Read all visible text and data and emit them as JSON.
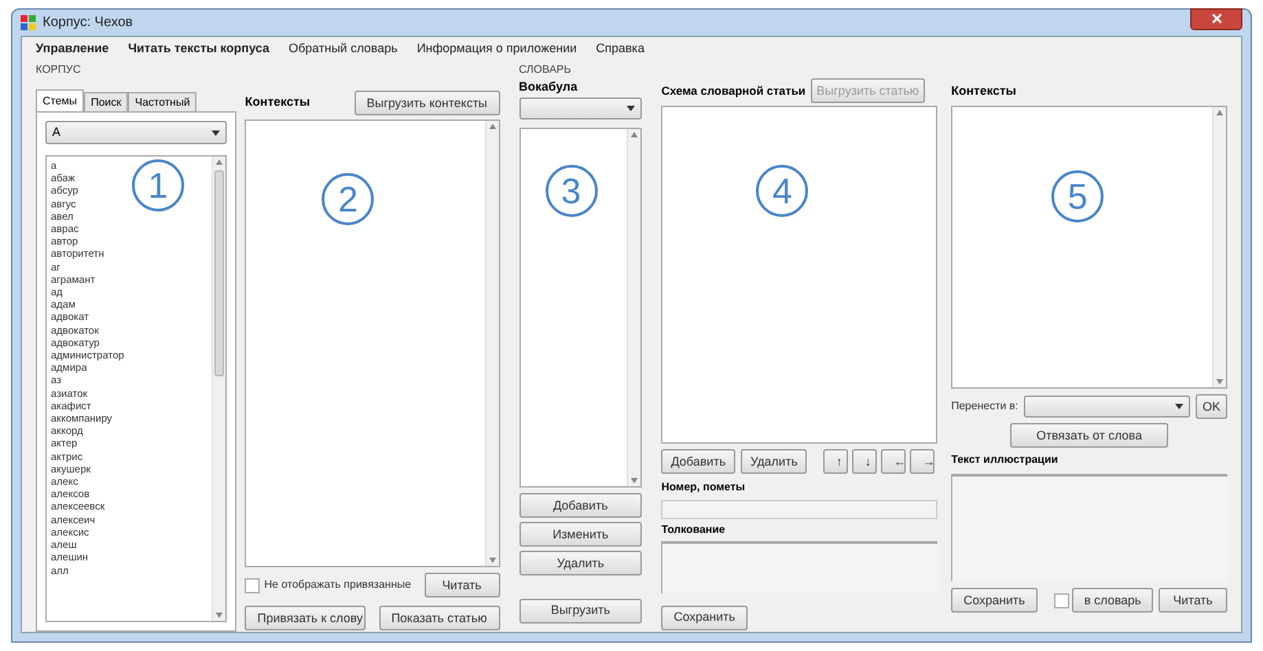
{
  "window": {
    "title": "Корпус: Чехов"
  },
  "menu": [
    {
      "label": "Управление",
      "bold": true
    },
    {
      "label": "Читать тексты корпуса",
      "bold": true
    },
    {
      "label": "Обратный словарь",
      "bold": false
    },
    {
      "label": "Информация о приложении",
      "bold": false
    },
    {
      "label": "Справка",
      "bold": false
    }
  ],
  "corpus": {
    "label": "КОРПУС",
    "tabs": [
      {
        "label": "Стемы",
        "selected": true
      },
      {
        "label": "Поиск",
        "selected": false
      },
      {
        "label": "Частотный",
        "selected": false
      }
    ],
    "letter_select": "А",
    "annotation": "1",
    "words": [
      "а",
      "абаж",
      "абсур",
      "авгус",
      "авел",
      "аврас",
      "автор",
      "авторитетн",
      "аг",
      "аграмант",
      "ад",
      "адам",
      "адвокат",
      "адвокаток",
      "адвокатур",
      "администратор",
      "адмира",
      "аз",
      "азиаток",
      "акафист",
      "аккомпаниру",
      "аккорд",
      "актер",
      "актрис",
      "акушерк",
      "алекс",
      "алексов",
      "алексеевск",
      "алексеич",
      "алексис",
      "алеш",
      "алешин",
      "алл"
    ]
  },
  "contexts": {
    "title": "Контексты",
    "export_button": "Выгрузить контексты",
    "annotation": "2",
    "hide_bound": {
      "label": "Не отображать привязанные",
      "checked": false
    },
    "read_button": "Читать",
    "bind_button": "Привязать к слову",
    "show_article_button": "Показать статью"
  },
  "dictionary": {
    "label": "СЛОВАРЬ",
    "vocab": {
      "title": "Вокабула",
      "annotation": "3",
      "buttons": [
        "Добавить",
        "Изменить",
        "Удалить"
      ],
      "export_button": "Выгрузить"
    },
    "scheme": {
      "title": "Схема словарной статьи",
      "export_button": {
        "label": "Выгрузить статью",
        "disabled": true
      },
      "annotation": "4",
      "buttons": [
        "Добавить",
        "Удалить"
      ],
      "arrows": [
        "↑",
        "↓",
        "←",
        "→"
      ],
      "number_label": "Номер, пометы",
      "interpretation_label": "Толкование",
      "save_button": "Сохранить"
    }
  },
  "right": {
    "title": "Контексты",
    "annotation": "5",
    "move_label": "Перенести в:",
    "ok_button": "OK",
    "unbind_button": "Отвязать от слова",
    "illustration_label": "Текст иллюстрации",
    "save_button": "Сохранить",
    "to_dict": {
      "label": "в словарь",
      "checked": false
    },
    "read_button": "Читать"
  }
}
